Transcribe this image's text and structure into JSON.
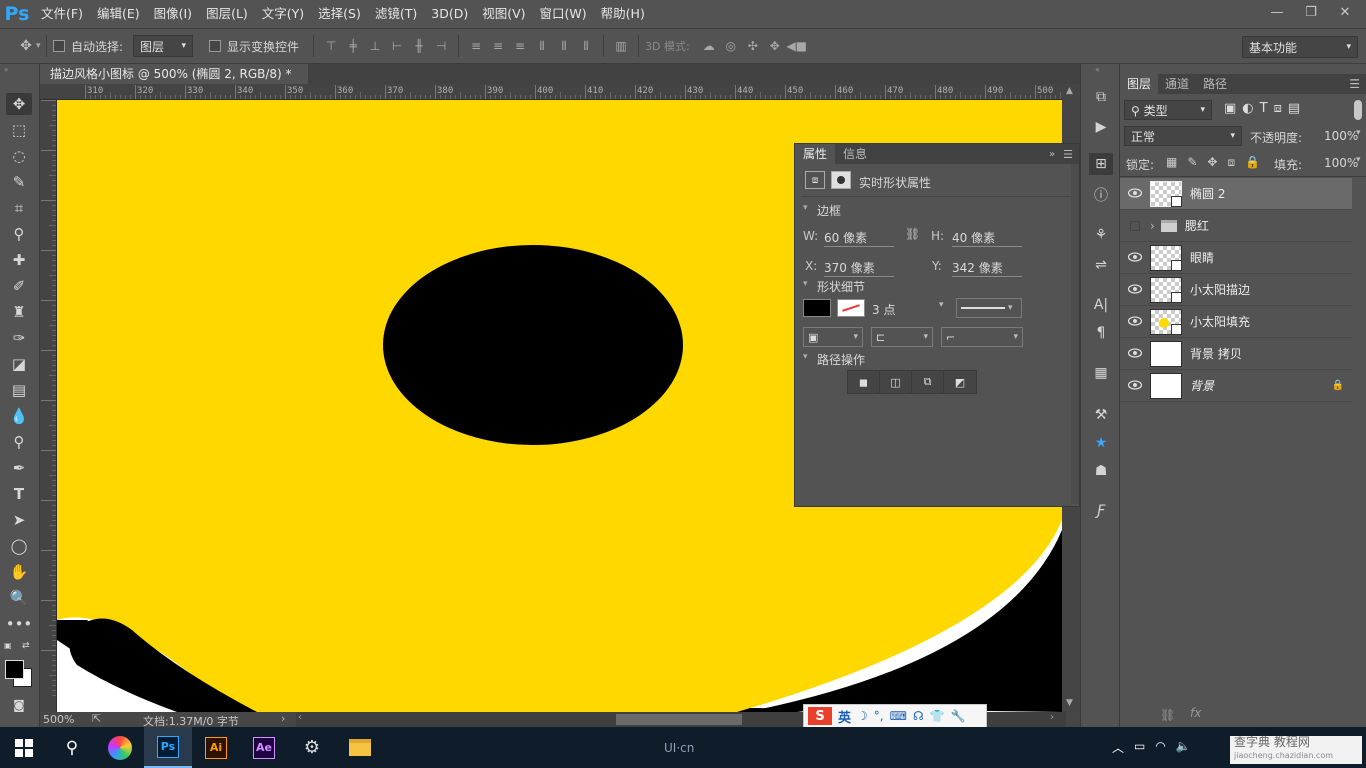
{
  "app": {
    "logo": "Ps"
  },
  "menu": [
    "文件(F)",
    "编辑(E)",
    "图像(I)",
    "图层(L)",
    "文字(Y)",
    "选择(S)",
    "滤镜(T)",
    "3D(D)",
    "视图(V)",
    "窗口(W)",
    "帮助(H)"
  ],
  "options": {
    "auto_select_label": "自动选择:",
    "auto_select_target": "图层",
    "show_transform_label": "显示变换控件",
    "mode_3d_label": "3D 模式:",
    "workspace": "基本功能"
  },
  "document": {
    "tab_title": "描边风格小图标 @ 500% (椭圆 2, RGB/8) *",
    "close": "×"
  },
  "ruler": {
    "h_ticks": [
      "310",
      "320",
      "330",
      "340",
      "350",
      "360",
      "370",
      "380",
      "390",
      "400",
      "410",
      "420",
      "430",
      "440",
      "450",
      "460",
      "470",
      "480",
      "490",
      "500"
    ],
    "v_ticks": [
      "3",
      "3",
      "3",
      "3",
      "3",
      "3",
      "4",
      "4",
      "4",
      "4",
      "4",
      "4",
      "4",
      "4",
      "4",
      "4",
      "4",
      "4",
      "4",
      "4",
      "4"
    ],
    "v_ticks_full": [
      "1",
      "0",
      "2",
      "0",
      "3",
      "0",
      "3",
      "4",
      "5",
      "6",
      "7",
      "8",
      "9",
      "0",
      "1",
      "2",
      "3",
      "4",
      "5",
      "6",
      "7",
      "8",
      "9"
    ]
  },
  "status": {
    "zoom": "500%",
    "doc_info": "文档:1.37M/0 字节"
  },
  "properties": {
    "tab_props": "属性",
    "tab_info": "信息",
    "header": "实时形状属性",
    "section_bounds": "边框",
    "w_label": "W:",
    "w_value": "60 像素",
    "h_label": "H:",
    "h_value": "40 像素",
    "x_label": "X:",
    "x_value": "370 像素",
    "y_label": "Y:",
    "y_value": "342 像素",
    "section_shape": "形状细节",
    "stroke_width": "3 点",
    "section_path": "路径操作",
    "fill_color": "#000000"
  },
  "layers": {
    "tabs": [
      "图层",
      "通道",
      "路径"
    ],
    "filter_label": "类型",
    "blend_mode": "正常",
    "opacity_label": "不透明度:",
    "opacity_value": "100%",
    "lock_label": "锁定:",
    "fill_label": "填充:",
    "fill_value": "100%",
    "items": [
      {
        "name": "椭圆 2",
        "kind": "shape",
        "selected": true,
        "visible": true
      },
      {
        "name": "腮红",
        "kind": "group",
        "selected": false,
        "visible": false
      },
      {
        "name": "眼睛",
        "kind": "shape",
        "selected": false,
        "visible": true
      },
      {
        "name": "小太阳描边",
        "kind": "shape",
        "selected": false,
        "visible": true
      },
      {
        "name": "小太阳填充",
        "kind": "shape-yellow",
        "selected": false,
        "visible": true
      },
      {
        "name": "背景 拷贝",
        "kind": "white",
        "selected": false,
        "visible": true
      },
      {
        "name": "背景",
        "kind": "white-locked",
        "selected": false,
        "visible": true
      }
    ]
  },
  "ime": {
    "lang": "英"
  },
  "taskbar": {
    "watermark": "UI·cn",
    "site_text": "查字典 教程网",
    "site_url": "jiaocheng.chazidian.com"
  },
  "colors": {
    "yellow": "#ffd800",
    "black": "#000000",
    "ui_bg": "#535353",
    "accent": "#31a8ff"
  }
}
